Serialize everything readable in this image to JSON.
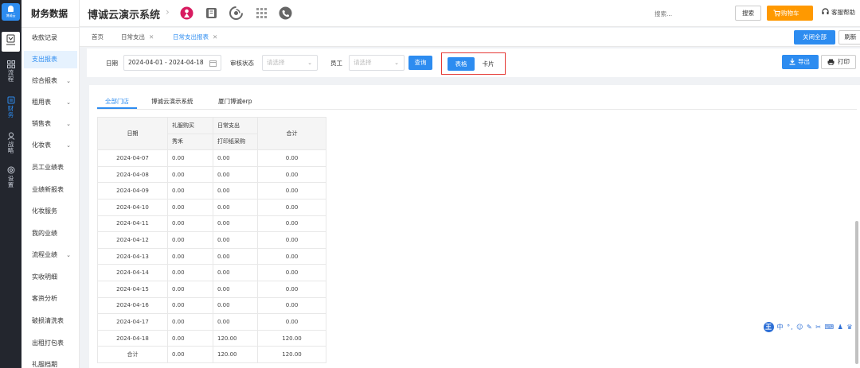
{
  "rail": {
    "logo_text": "博诚云",
    "items": [
      {
        "label": "流程",
        "icon": "grid-icon"
      },
      {
        "label": "财务",
        "icon": "finance-icon"
      },
      {
        "label": "战略",
        "icon": "strategy-icon"
      },
      {
        "label": "设置",
        "icon": "settings-icon"
      }
    ]
  },
  "submenu": {
    "title": "财务数据",
    "items": [
      {
        "label": "收款记录",
        "has_children": false
      },
      {
        "label": "支出报表",
        "has_children": false
      },
      {
        "label": "综合报表",
        "has_children": true
      },
      {
        "label": "租用表",
        "has_children": true
      },
      {
        "label": "销售表",
        "has_children": true
      },
      {
        "label": "化妆表",
        "has_children": true
      },
      {
        "label": "员工业绩表",
        "has_children": false
      },
      {
        "label": "业绩新报表",
        "has_children": false
      },
      {
        "label": "化妆服务",
        "has_children": false
      },
      {
        "label": "我的业绩",
        "has_children": false
      },
      {
        "label": "流程业绩",
        "has_children": true
      },
      {
        "label": "实收明细",
        "has_children": false
      },
      {
        "label": "客资分析",
        "has_children": false
      },
      {
        "label": "破损清洗表",
        "has_children": false
      },
      {
        "label": "出租打包表",
        "has_children": false
      },
      {
        "label": "礼服档期",
        "has_children": false
      }
    ]
  },
  "header": {
    "app_title": "博诚云演示系统",
    "search_placeholder": "搜索...",
    "search_label": "搜索",
    "cart_label": "购物车",
    "help_label": "客服帮助"
  },
  "tabs": {
    "items": [
      {
        "label": "首页",
        "closable": false
      },
      {
        "label": "日常支出",
        "closable": true
      },
      {
        "label": "日常支出报表",
        "closable": true
      }
    ],
    "close_all_label": "关闭全部",
    "refresh_label": "刷新"
  },
  "filters": {
    "date_label": "日期",
    "date_value": "2024-04-01 - 2024-04-18",
    "audit_label": "审核状态",
    "audit_placeholder": "请选择",
    "staff_label": "员工",
    "staff_placeholder": "请选择",
    "query_label": "查询",
    "view_table_label": "表格",
    "view_card_label": "卡片",
    "export_label": "导出",
    "print_label": "打印"
  },
  "content_tabs": [
    "全部门店",
    "博诚云演示系统",
    "厦门博诚erp"
  ],
  "table": {
    "header_date": "日期",
    "group1": "礼服购买",
    "group1_sub": "秀禾",
    "group2": "日常支出",
    "group2_sub": "打印纸采购",
    "header_total": "合计",
    "rows": [
      [
        "2024-04-07",
        "0.00",
        "0.00",
        "0.00"
      ],
      [
        "2024-04-08",
        "0.00",
        "0.00",
        "0.00"
      ],
      [
        "2024-04-09",
        "0.00",
        "0.00",
        "0.00"
      ],
      [
        "2024-04-10",
        "0.00",
        "0.00",
        "0.00"
      ],
      [
        "2024-04-11",
        "0.00",
        "0.00",
        "0.00"
      ],
      [
        "2024-04-12",
        "0.00",
        "0.00",
        "0.00"
      ],
      [
        "2024-04-13",
        "0.00",
        "0.00",
        "0.00"
      ],
      [
        "2024-04-14",
        "0.00",
        "0.00",
        "0.00"
      ],
      [
        "2024-04-15",
        "0.00",
        "0.00",
        "0.00"
      ],
      [
        "2024-04-16",
        "0.00",
        "0.00",
        "0.00"
      ],
      [
        "2024-04-17",
        "0.00",
        "0.00",
        "0.00"
      ],
      [
        "2024-04-18",
        "0.00",
        "120.00",
        "120.00"
      ]
    ],
    "summary": [
      "合计",
      "0.00",
      "120.00",
      "120.00"
    ]
  },
  "ime": {
    "badge": "王",
    "text": "中 °, ☺ ✎ ✂ ⌨ ♟ ♛"
  },
  "colors": {
    "accent": "#2d8cf0",
    "cart": "#ff9900",
    "highlight": "#e53935",
    "rail": "#23262e"
  }
}
